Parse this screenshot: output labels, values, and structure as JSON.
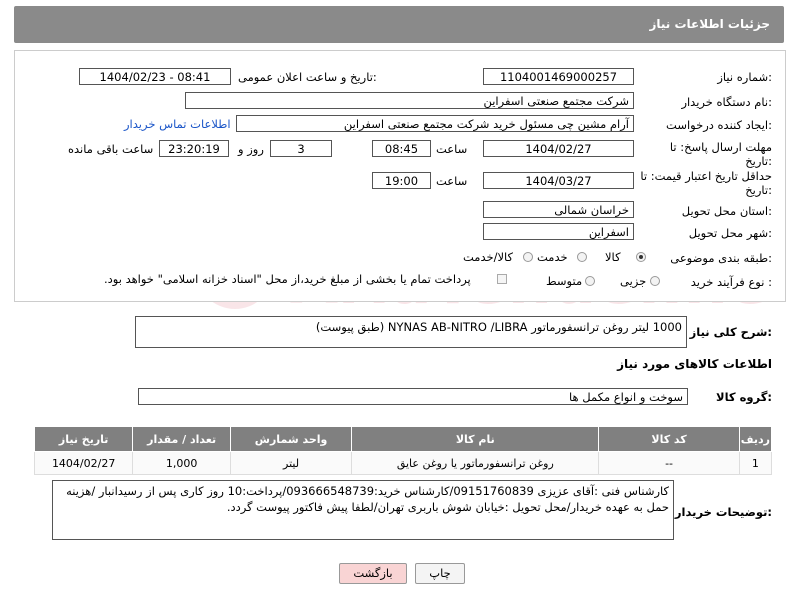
{
  "page": {
    "title": "جزئیات اطلاعات نیاز"
  },
  "fields": {
    "need_number_label": "شماره نیاز:",
    "need_number": "1104001469000257",
    "announce_label": "تاریخ و ساعت اعلان عمومی:",
    "announce_value": "1404/02/23 - 08:41",
    "buyer_org_label": "نام دستگاه خریدار:",
    "buyer_org": "شرکت مجتمع صنعتی اسفراین",
    "requester_label": "ایجاد کننده درخواست:",
    "requester": "آرام مشین چی مسئول خرید شرکت مجتمع صنعتی اسفراین",
    "contact_link": "اطلاعات تماس خریدار",
    "deadline_label": "مهلت ارسال پاسخ: تا تاریخ:",
    "deadline_date": "1404/02/27",
    "time_label": "ساعت",
    "deadline_time": "08:45",
    "days": "3",
    "days_label": "روز و",
    "remaining_time": "23:20:19",
    "remaining_label": "ساعت باقی مانده",
    "validity_label": "حداقل تاریخ اعتبار قیمت: تا تاریخ:",
    "validity_date": "1404/03/27",
    "validity_time": "19:00",
    "province_label": "استان محل تحویل:",
    "province": "خراسان شمالی",
    "city_label": "شهر محل تحویل:",
    "city": "اسفراین",
    "category_label": "طبقه بندی موضوعی:",
    "category_options": [
      "کالا",
      "خدمت",
      "کالا/خدمت"
    ],
    "process_label": "نوع فرآیند خرید :",
    "process_options": [
      "جزیی",
      "متوسط"
    ],
    "payment_note": "پرداخت تمام یا بخشی از مبلغ خرید،از محل \"اسناد خزانه اسلامی\" خواهد بود."
  },
  "description": {
    "label": "شرح کلی نیاز:",
    "text": "1000 لیتر روغن ترانسفورماتور NYNAS AB-NITRO  /LIBRA (طبق پیوست)"
  },
  "goods": {
    "section_title": "اطلاعات کالاهای مورد نیاز",
    "group_label": "گروه کالا:",
    "group_value": "سوخت و انواع مکمل ها",
    "columns": [
      "ردیف",
      "کد کالا",
      "نام کالا",
      "واحد شمارش",
      "تعداد / مقدار",
      "تاریخ نیاز"
    ],
    "rows": [
      {
        "row": "1",
        "code": "--",
        "name": "روغن ترانسفورماتور یا روغن عایق",
        "unit": "لیتر",
        "qty": "1,000",
        "date": "1404/02/27"
      }
    ]
  },
  "buyer_notes": {
    "label": "توضیحات خریدار:",
    "text": "کارشناس فنی :آقای عزیزی 09151760839/کارشناس خرید:093666548739/پرداخت:10 روز کاری پس از رسیدانبار /هزینه حمل به عهده خریدار/محل تحویل :خیابان شوش باربری تهران/لطفا پیش فاکتور پیوست گردد."
  },
  "buttons": {
    "print": "چاپ",
    "back": "بازگشت"
  },
  "watermark": "AriaTender.neT",
  "colors": {
    "header": "#8a8a8a",
    "link": "#1a55c8",
    "back_button": "#f9d4d4",
    "watermark": "#c8102e"
  }
}
